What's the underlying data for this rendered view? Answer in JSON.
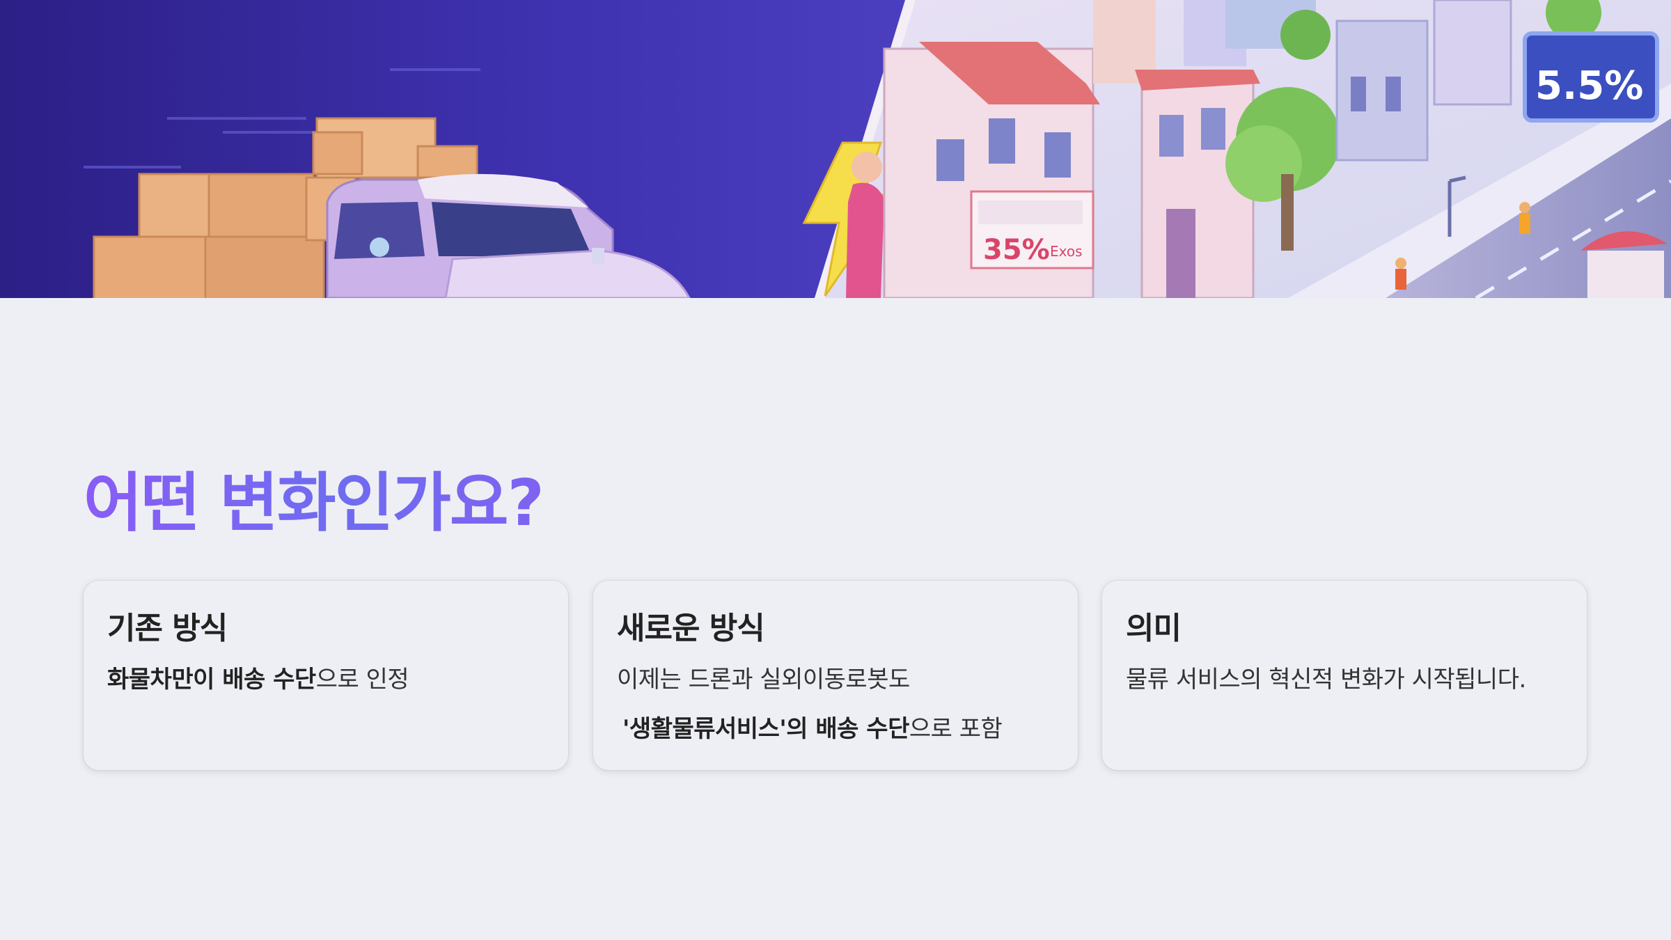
{
  "heading": "어떤 변화인가요?",
  "hero": {
    "sign_percent_left": "35%",
    "sign_left_caption": "Exos",
    "sign_percent_right": "5.5%"
  },
  "cards": [
    {
      "title": "기존 방식",
      "lines": [
        {
          "bold": "화물차만이 배송 수단",
          "rest": "으로 인정"
        }
      ]
    },
    {
      "title": "새로운 방식",
      "lines": [
        {
          "bold": "",
          "rest": "이제는 드론과 실외이동로봇도"
        },
        {
          "bold": "'생활물류서비스'의 배송 수단",
          "rest": "으로 포함"
        }
      ]
    },
    {
      "title": "의미",
      "lines": [
        {
          "bold": "",
          "rest": "물류 서비스의 혁신적 변화가 시작됩니다."
        }
      ]
    }
  ],
  "colors": {
    "background": "#eeeff4",
    "heading_gradient_start": "#8a5cf6",
    "heading_gradient_end": "#6e6cf0",
    "hero_left": "#3a2aa0",
    "hero_right_sky": "#dcd8f2"
  }
}
